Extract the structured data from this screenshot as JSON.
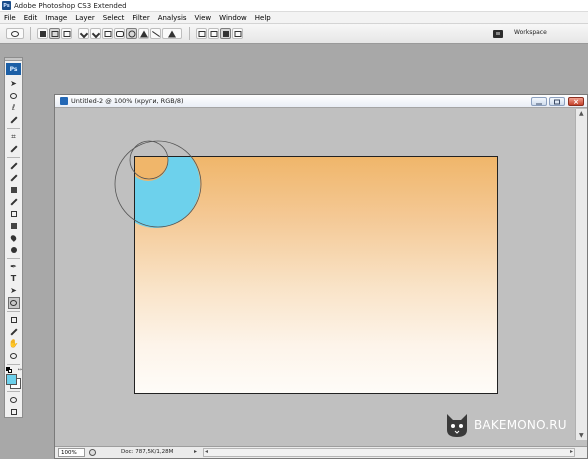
{
  "app": {
    "title": "Adobe Photoshop CS3 Extended",
    "icon": "photoshop-app-icon"
  },
  "menu": [
    "File",
    "Edit",
    "Image",
    "Layer",
    "Select",
    "Filter",
    "Analysis",
    "View",
    "Window",
    "Help"
  ],
  "options_bar": {
    "tool_preset_icon": "ellipse-tool-icon",
    "shape_buttons": [
      "shape-layers-icon",
      "paths-icon",
      "fill-pixels-icon",
      "pen-icon",
      "freeform-pen-icon",
      "rectangle-icon",
      "rounded-rectangle-icon",
      "ellipse-icon",
      "polygon-icon",
      "line-icon",
      "custom-shape-icon"
    ],
    "selected_shape": "ellipse-icon",
    "mode_buttons": [
      "add-to-shape-area-icon",
      "subtract-from-shape-area-icon",
      "intersect-shape-areas-icon",
      "exclude-overlapping-icon"
    ],
    "workspace_label": "Workspace"
  },
  "toolbox": {
    "logo": "Ps",
    "tools": [
      "move-icon",
      "marquee-icon",
      "lasso-icon",
      "magic-wand-icon",
      "crop-icon",
      "slice-icon",
      "healing-brush-icon",
      "brush-icon",
      "clone-stamp-icon",
      "history-brush-icon",
      "eraser-icon",
      "gradient-icon",
      "blur-icon",
      "dodge-icon",
      "pen-tool-icon",
      "type-icon",
      "path-selection-icon",
      "ellipse-shape-icon",
      "notes-icon",
      "eyedropper-icon",
      "hand-icon",
      "zoom-icon"
    ],
    "selected_tool": "ellipse-shape-icon",
    "foreground_color": "#6dd1ec",
    "background_color": "#ffffff",
    "quick_mask_icon": "quick-mask-icon",
    "screen_mode_icon": "screen-mode-icon"
  },
  "document": {
    "title": "Untitled-2 @ 100% (круги, RGB/8)",
    "gradient_top": "#f0b66a",
    "gradient_bottom": "#fefcf8",
    "shape_fill": "#6dd1ec",
    "zoom": "100%",
    "doc_info": "Doc: 787,5K/1,28M"
  },
  "watermark": {
    "text": "BAKEMONO.RU",
    "icon": "cat-face-icon"
  }
}
